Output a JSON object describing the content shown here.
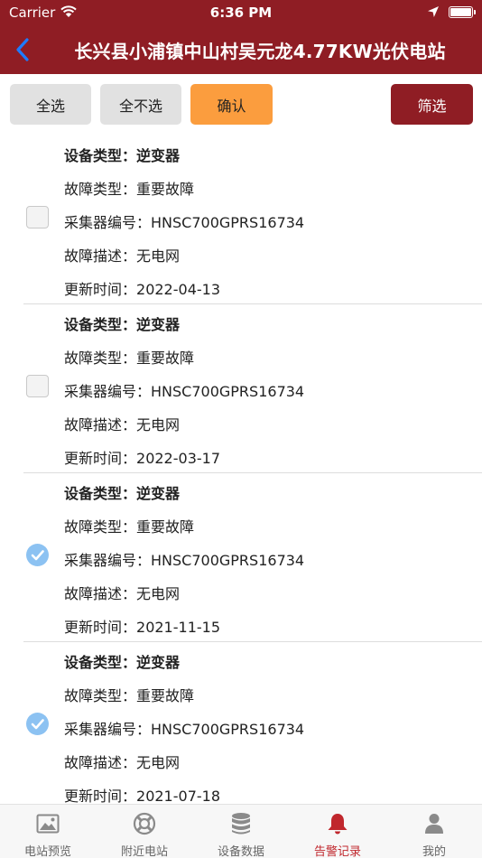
{
  "status_bar": {
    "carrier": "Carrier",
    "time": "6:36 PM"
  },
  "nav": {
    "title": "长兴县小浦镇中山村吴元龙4.77KW光伏电站"
  },
  "toolbar": {
    "select_all": "全选",
    "select_none": "全不选",
    "confirm": "确认",
    "filter": "筛选"
  },
  "labels": {
    "device_type": "设备类型：",
    "fault_type": "故障类型：",
    "collector_no": "采集器编号：",
    "fault_desc": "故障描述：",
    "update_time": "更新时间："
  },
  "records": [
    {
      "checked": false,
      "device_type": "逆变器",
      "fault_type": "重要故障",
      "collector_no": "HNSC700GPRS16734",
      "fault_desc": "无电网",
      "update_time": "2022-04-13"
    },
    {
      "checked": false,
      "device_type": "逆变器",
      "fault_type": "重要故障",
      "collector_no": "HNSC700GPRS16734",
      "fault_desc": "无电网",
      "update_time": "2022-03-17"
    },
    {
      "checked": true,
      "device_type": "逆变器",
      "fault_type": "重要故障",
      "collector_no": "HNSC700GPRS16734",
      "fault_desc": "无电网",
      "update_time": "2021-11-15"
    },
    {
      "checked": true,
      "device_type": "逆变器",
      "fault_type": "重要故障",
      "collector_no": "HNSC700GPRS16734",
      "fault_desc": "无电网",
      "update_time": "2021-07-18"
    }
  ],
  "tabs": [
    {
      "label": "电站预览",
      "icon": "image-icon",
      "active": false
    },
    {
      "label": "附近电站",
      "icon": "lifebuoy-icon",
      "active": false
    },
    {
      "label": "设备数据",
      "icon": "database-icon",
      "active": false
    },
    {
      "label": "告警记录",
      "icon": "bell-icon",
      "active": true
    },
    {
      "label": "我的",
      "icon": "user-icon",
      "active": false
    }
  ],
  "colors": {
    "brand": "#8f1d24",
    "confirm": "#fb9d3e",
    "active_tab": "#c0272d",
    "checkbox_on": "#8cc2f2"
  }
}
